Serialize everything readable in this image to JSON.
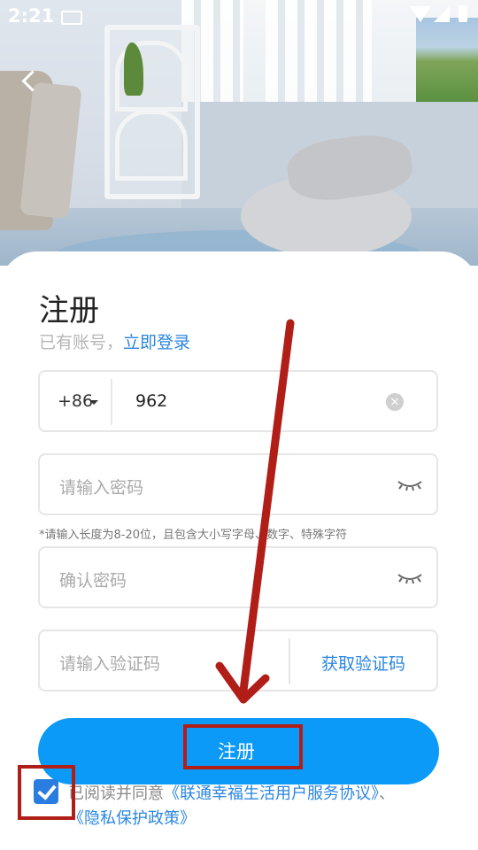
{
  "status_bar": {
    "time": "2:21"
  },
  "register": {
    "title": "注册",
    "have_account": "已有账号，",
    "login_link": "立即登录",
    "country_code": "+86",
    "phone_value": "962",
    "password_placeholder": "请输入密码",
    "password_hint": "*请输入长度为8-20位，且包含大小写字母、数字、特殊字符",
    "confirm_placeholder": "确认密码",
    "code_placeholder": "请输入验证码",
    "get_code": "获取验证码",
    "submit_label": "注册",
    "agree_prefix": "已阅读并同意",
    "agree_service": "《联通幸福生活用户服务协议》",
    "agree_sep": "、",
    "agree_privacy": "《隐私保护政策》"
  },
  "colors": {
    "accent": "#2a86e0",
    "button": "#0b9af7",
    "annotation": "#b11e17"
  },
  "icons": [
    "back-arrow-icon",
    "keyboard-icon",
    "wifi-icon",
    "signal-icon",
    "battery-icon",
    "clear-icon",
    "eye-closed-icon",
    "checkmark-icon"
  ]
}
